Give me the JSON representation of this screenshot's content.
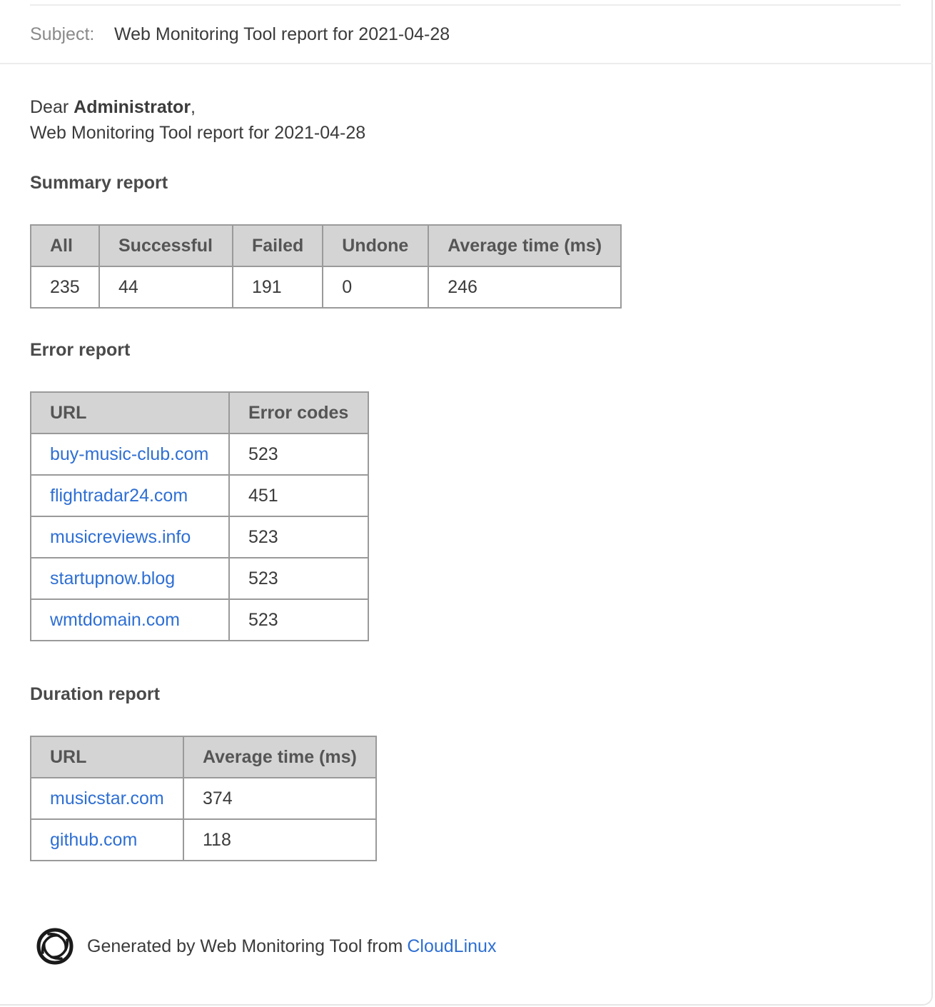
{
  "header": {
    "subject_label": "Subject:",
    "subject_value": "Web Monitoring Tool report for 2021-04-28"
  },
  "greeting": {
    "prefix": "Dear ",
    "name": "Administrator",
    "suffix": ",",
    "line2": "Web Monitoring Tool report for 2021-04-28"
  },
  "summary": {
    "title": "Summary report",
    "headers": [
      "All",
      "Successful",
      "Failed",
      "Undone",
      "Average time (ms)"
    ],
    "row": [
      "235",
      "44",
      "191",
      "0",
      "246"
    ]
  },
  "errors": {
    "title": "Error report",
    "headers": [
      "URL",
      "Error codes"
    ],
    "rows": [
      [
        "buy-music-club.com",
        "523"
      ],
      [
        "flightradar24.com",
        "451"
      ],
      [
        "musicreviews.info",
        "523"
      ],
      [
        "startupnow.blog",
        "523"
      ],
      [
        "wmtdomain.com",
        "523"
      ]
    ]
  },
  "duration": {
    "title": "Duration report",
    "headers": [
      "URL",
      "Average time (ms)"
    ],
    "rows": [
      [
        "musicstar.com",
        "374"
      ],
      [
        "github.com",
        "118"
      ]
    ]
  },
  "footer": {
    "text": "Generated by Web Monitoring Tool from ",
    "link": "CloudLinux",
    "logo_icon": "cloudlinux-logo-icon"
  },
  "colors": {
    "link": "#2e6fd3",
    "header_bg": "#d4d4d4",
    "border": "#9a9a9a"
  }
}
